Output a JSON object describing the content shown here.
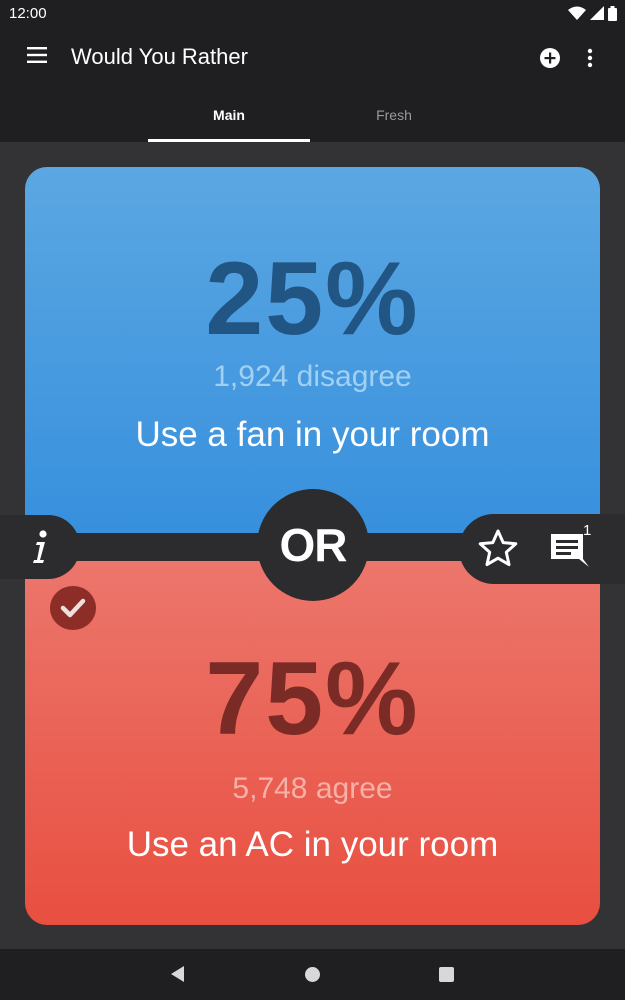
{
  "status_bar": {
    "time": "12:00",
    "icons": [
      "wifi-icon",
      "signal-icon",
      "battery-icon"
    ]
  },
  "app_bar": {
    "title": "Would You Rather",
    "icons": [
      "menu-icon",
      "add-circle-icon",
      "more-vert-icon"
    ]
  },
  "tabs": [
    {
      "label": "Main",
      "selected": true
    },
    {
      "label": "Fresh",
      "selected": false
    }
  ],
  "question": {
    "option_a": {
      "percent": "25%",
      "count_text": "1,924 disagree",
      "text": "Use a fan in your room"
    },
    "option_b": {
      "percent": "75%",
      "count_text": "5,748 agree",
      "text": "Use an AC in your room",
      "chosen": true
    },
    "or_label": "OR",
    "comment_count": "1"
  },
  "colors": {
    "option_a_bg": "#3a92de",
    "option_b_bg": "#e9594a",
    "bar_bg": "#1f1e21",
    "page_bg": "#333235"
  },
  "nav_bar": {
    "icons": [
      "back-icon",
      "home-icon",
      "recents-icon"
    ]
  }
}
